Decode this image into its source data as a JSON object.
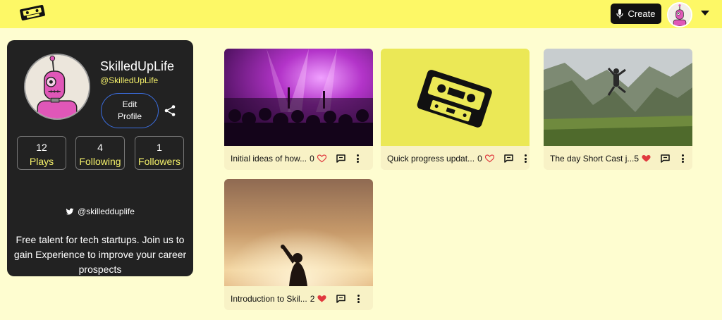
{
  "colors": {
    "accent_yellow": "#fdf866",
    "background": "#fefdd0",
    "card_dark": "#222222",
    "heart_red": "#e0393e",
    "edit_border": "#3b6ee0"
  },
  "header": {
    "logo_icon": "cassette-logo-icon",
    "create_label": "Create",
    "mic_icon": "microphone-icon",
    "menu_icon": "chevron-down-icon"
  },
  "profile": {
    "name": "SkilledUpLife",
    "handle": "@SkilledUpLife",
    "edit_label": "Edit Profile",
    "share_icon": "share-icon",
    "stats": [
      {
        "num": "12",
        "label": "Plays"
      },
      {
        "num": "4",
        "label": "Following"
      },
      {
        "num": "1",
        "label": "Followers"
      }
    ],
    "twitter": "@skilledduplife",
    "bio": "Free talent for tech startups. Join us to gain Experience to improve your career prospects"
  },
  "casts": [
    {
      "title": "Initial ideas of how...",
      "count": "0",
      "liked": false
    },
    {
      "title": "Quick progress updat...",
      "count": "0",
      "liked": false
    },
    {
      "title": "The day Short Cast j...",
      "count": "5",
      "liked": true
    },
    {
      "title": "Introduction to Skil...",
      "count": "2",
      "liked": true
    }
  ]
}
